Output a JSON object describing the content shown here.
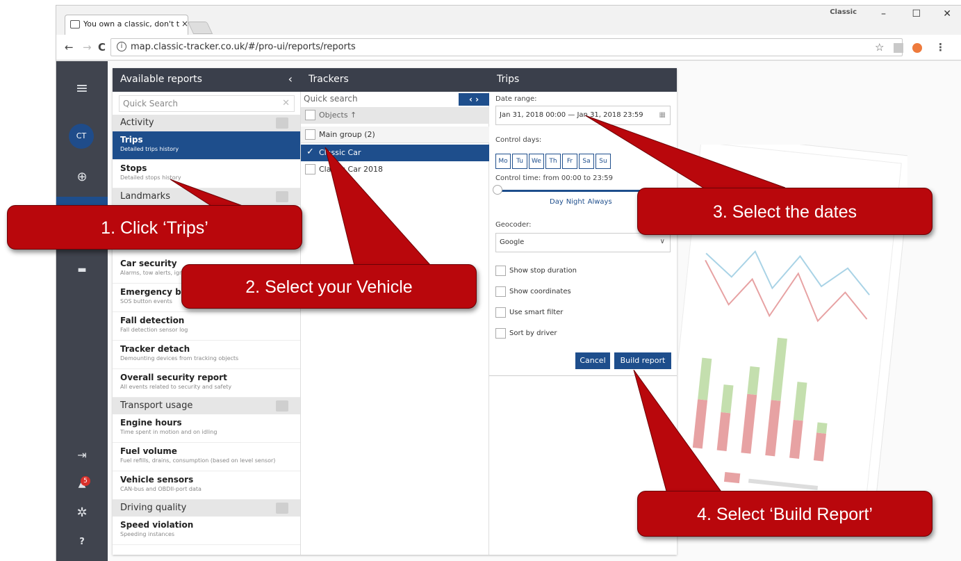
{
  "browser": {
    "tab_title": "You own a classic, don't t",
    "tab_close": "×",
    "window_label": "Classic",
    "minimize": "–",
    "maximize": "☐",
    "close": "✕",
    "url": "map.classic-tracker.co.uk/#/pro-ui/reports/reports",
    "back": "←",
    "forward": "→",
    "reload": "C",
    "info": "i",
    "star": "☆",
    "menu": "⋮"
  },
  "sidebar": {
    "menu_icon": "≡",
    "avatar": "CT",
    "globe_icon": "⊕",
    "car_icon": "▬",
    "logout_icon": "⇥",
    "bell_icon": "▲",
    "notifications": "5",
    "settings_icon": "✲",
    "help_icon": "?"
  },
  "available_reports": {
    "title": "Available reports",
    "collapse": "‹",
    "search_placeholder": "Quick Search",
    "search_clear": "✕",
    "groups": [
      {
        "label": "Activity"
      },
      {
        "label": "Landmarks"
      },
      {
        "label": "Transport usage"
      },
      {
        "label": "Driving quality"
      }
    ],
    "items": [
      {
        "title": "Trips",
        "desc": "Detailed trips history"
      },
      {
        "title": "Stops",
        "desc": "Detailed stops history"
      },
      {
        "title": "Car security",
        "desc": "Alarms, tow alerts, ignition"
      },
      {
        "title": "Emergency button",
        "desc": "SOS button events"
      },
      {
        "title": "Fall detection",
        "desc": "Fall detection sensor log"
      },
      {
        "title": "Tracker detach",
        "desc": "Demounting devices from tracking objects"
      },
      {
        "title": "Overall security report",
        "desc": "All events related to security and safety"
      },
      {
        "title": "Engine hours",
        "desc": "Time spent in motion and on idling"
      },
      {
        "title": "Fuel volume",
        "desc": "Fuel refills, drains, consumption (based on level sensor)"
      },
      {
        "title": "Vehicle sensors",
        "desc": "CAN-bus and OBDII-port data"
      },
      {
        "title": "Speed violation",
        "desc": "Speeding instances"
      }
    ]
  },
  "trackers": {
    "title": "Trackers",
    "search_placeholder": "Quick search",
    "arrows": "‹ ›",
    "objects_header": "Objects ↑",
    "group": "Main group (2)",
    "vehicles": [
      {
        "name": "Classic Car",
        "check": "✓"
      },
      {
        "name": "Classic Car 2018"
      }
    ]
  },
  "trips": {
    "title": "Trips",
    "date_range_label": "Date range:",
    "date_range": "Jan 31, 2018 00:00 — Jan 31, 2018 23:59",
    "calendar_icon": "▦",
    "control_days_label": "Control days:",
    "days": [
      "Mo",
      "Tu",
      "We",
      "Th",
      "Fr",
      "Sa",
      "Su"
    ],
    "control_time": "Control time: from 00:00 to 23:59",
    "time_presets": [
      "Day",
      "Night",
      "Always"
    ],
    "geocoder_label": "Geocoder:",
    "geocoder": "Google",
    "dropdown_icon": "∨",
    "options": [
      "Show stop duration",
      "Show coordinates",
      "Use smart filter",
      "Sort by driver"
    ],
    "cancel": "Cancel",
    "build": "Build report"
  },
  "callouts": [
    "1. Click ‘Trips’",
    "2. Select your Vehicle",
    "3. Select the dates",
    "4. Select ‘Build Report’"
  ],
  "colors": {
    "accent": "#1e4e8c",
    "sidebar": "#40444e",
    "header": "#3a3f4b",
    "callout": "#b9070c"
  }
}
